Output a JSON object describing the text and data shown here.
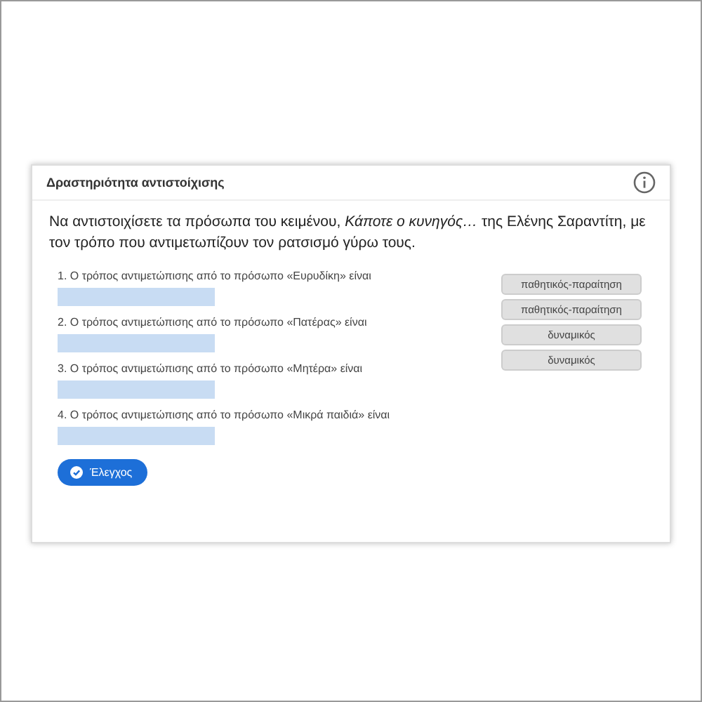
{
  "activity": {
    "title": "Δραστηριότητα αντιστοίχισης",
    "instruction": "Να αντιστοιχίσετε τα πρόσωπα του κειμένου, *Κάποτε ο κυνηγός…* της Ελένης Σαραντίτη, με τον τρόπο που αντιμετωπίζουν τον ρατσισμό γύρω τους.",
    "questions": [
      {
        "text": "1. Ο τρόπος αντιμετώπισης από το πρόσωπο «Ευρυδίκη» είναι"
      },
      {
        "text": "2. Ο τρόπος αντιμετώπισης από το πρόσωπο «Πατέρας» είναι"
      },
      {
        "text": "3. Ο τρόπος αντιμετώπισης από το πρόσωπο «Μητέρα» είναι"
      },
      {
        "text": "4. Ο τρόπος αντιμετώπισης από το πρόσωπο «Μικρά παιδιά» είναι"
      }
    ],
    "options": [
      "παθητικός-παραίτηση",
      "παθητικός-παραίτηση",
      "δυναμικός",
      "δυναμικός"
    ],
    "check_button": "Έλεγχος"
  }
}
